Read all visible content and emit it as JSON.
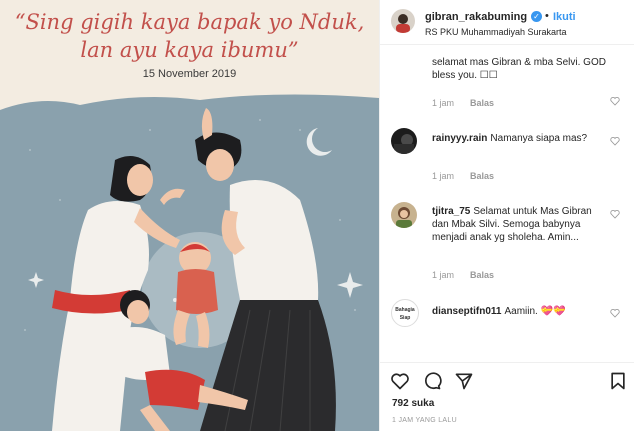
{
  "post": {
    "caption_line1": "“Sing gigih kaya bapak yo Nduk,",
    "caption_line2": "lan ayu kaya ibumu”",
    "date": "15 November 2019",
    "image_name": "family-illustration"
  },
  "header": {
    "username": "gibran_rakabuming",
    "verified_symbol": "✓",
    "separator": "•",
    "follow_label": "Ikuti",
    "location": "RS PKU Muhammadiyah Surakarta"
  },
  "comments": [
    {
      "username": "",
      "text": "selamat mas Gibran & mba Selvi. GOD bless you. ☐☐",
      "time": "1 jam",
      "reply": "Balas",
      "avatar_icon": "none"
    },
    {
      "username": "rainyyy.rain",
      "text": "Namanya siapa mas?",
      "time": "1 jam",
      "reply": "Balas",
      "avatar_icon": "dark-avatar"
    },
    {
      "username": "tjitra_75",
      "text": "Selamat untuk Mas Gibran dan Mbak Silvi. Semoga babynya menjadi anak yg sholeha. Amin...",
      "time": "1 jam",
      "reply": "Balas",
      "avatar_icon": "photo-avatar"
    },
    {
      "username": "dianseptifn011",
      "text": "Aamiin. 💝💝",
      "time": "",
      "reply": "",
      "avatar_icon": "bahagia-avatar",
      "avatar_text1": "Bahagia",
      "avatar_text2": "Siap"
    }
  ],
  "actions": {
    "icons": [
      "heart-icon",
      "comment-icon",
      "share-icon",
      "bookmark-icon"
    ],
    "likes": "792 suka",
    "timestamp": "1 JAM YANG LALU"
  },
  "colors": {
    "caption": "#c2504b",
    "sky": "#8aa1ad",
    "verified": "#3897f0",
    "follow": "#3897f0"
  }
}
